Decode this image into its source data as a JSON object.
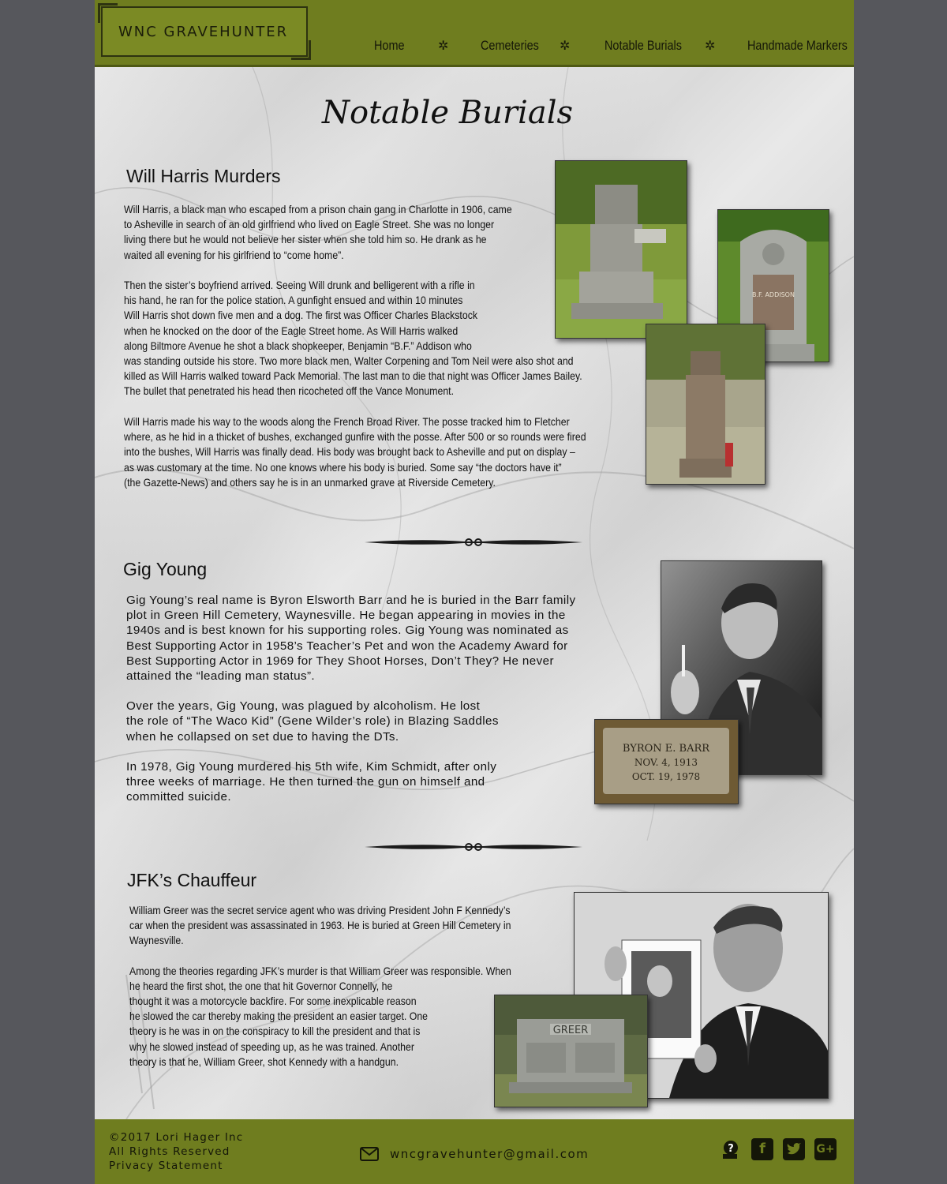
{
  "header": {
    "logo_text": "WNC GRAVEHUNTER",
    "nav": [
      "Home",
      "Cemeteries",
      "Notable Burials",
      "Handmade Markers"
    ],
    "nav_separator": "✲"
  },
  "page_title": "Notable Burials",
  "sections": {
    "harris": {
      "title": "Will Harris Murders",
      "p1": "Will Harris, a black man who escaped from a prison chain gang in Charlotte in 1906, came to Asheville in search of an old girlfriend who lived on Eagle Street.  She was no longer living there but he would not believe her sister when she told him so.  He drank as he waited all evening for his girlfriend to “come home”.",
      "p2_lines": [
        "Then the sister’s boyfriend arrived.  Seeing Will drunk and belligerent with a rifle in",
        "his hand, he ran for the police station.  A gunfight ensued and within 10 minutes",
        "Will Harris shot down five men and a dog.  The first was Officer Charles Blackstock",
        "when he knocked on the door of the Eagle Street home.  As Will Harris walked",
        "along Biltmore Avenue he shot a black shopkeeper, Benjamin “B.F.” Addison who",
        "was standing outside his store.  Two more black men, Walter Corpening and Tom Neil were also shot and",
        "killed as Will Harris walked toward Pack Memorial.  The last man to die that night was Officer James Bailey.",
        "The bullet that penetrated his head then ricocheted off the Vance Monument."
      ],
      "p3_lines": [
        "Will Harris made his way to the woods along the French Broad River.  The posse tracked him to Fletcher",
        "where, as he hid in a thicket of bushes, exchanged gunfire with the posse.  After 500 or so rounds were fired",
        "into the bushes, Will Harris was finally dead.  His body was brought back to Asheville and put on display –",
        "as was customary at the time.  No one knows where his body is buried.  Some say “the doctors have it”",
        "(the Gazette-News) and others say he is in an unmarked grave at Riverside Cemetery."
      ],
      "stone_text": "B.F. ADDISON"
    },
    "young": {
      "title": "Gig Young",
      "p1_lines": [
        "Gig Young’s real name is Byron Elsworth Barr and he is buried in the Barr family",
        "plot in Green Hill Cemetery, Waynesville.  He began appearing in movies in the",
        "1940s and is best known for his supporting roles.  Gig Young was nominated as",
        "Best Supporting Actor in 1958’s Teacher’s Pet and won the Academy Award for",
        "Best Supporting Actor in 1969 for They Shoot Horses, Don’t They?  He never",
        "attained the “leading man status”."
      ],
      "p2_lines": [
        "Over the years, Gig Young, was plagued by alcoholism.  He lost",
        "the role of “The Waco Kid” (Gene Wilder’s role) in Blazing Saddles",
        "when he collapsed on set due to having the DTs."
      ],
      "p3_lines": [
        "In 1978, Gig Young murdered his 5th wife, Kim Schmidt, after only",
        "three weeks of marriage.  He then turned the gun on himself and",
        "committed suicide."
      ],
      "plaque": [
        "BYRON  E.  BARR",
        "NOV.  4,  1913",
        "OCT.  19,  1978"
      ]
    },
    "greer": {
      "title": "JFK’s Chauffeur",
      "p1_lines": [
        "William Greer was the secret service agent who was driving President John F Kennedy’s",
        "car when the president was assassinated in 1963.  He is buried at Green Hill Cemetery in",
        "Waynesville."
      ],
      "p2_lines": [
        "Among the theories regarding JFK’s murder is that William Greer was responsible.  When",
        "he heard the first shot, the one that hit Governor Connelly, he",
        "thought it was a motorcycle backfire.  For some inexplicable reason",
        "he slowed the car thereby making the president an easier target.  One",
        "theory is he was in on the conspiracy to kill the president and that is",
        "why he slowed instead of speeding up, as he was trained.  Another",
        "theory is that he, William Greer, shot Kennedy with a handgun."
      ],
      "stone_text": "GREER"
    }
  },
  "footer": {
    "copyright": "©2017 Lori Hager Inc",
    "rights": "All Rights Reserved",
    "privacy": "Privacy Statement",
    "email": "wncgravehunter@gmail.com",
    "social_icons": [
      "find-a-grave-icon",
      "facebook-icon",
      "twitter-icon",
      "google-plus-icon"
    ]
  }
}
